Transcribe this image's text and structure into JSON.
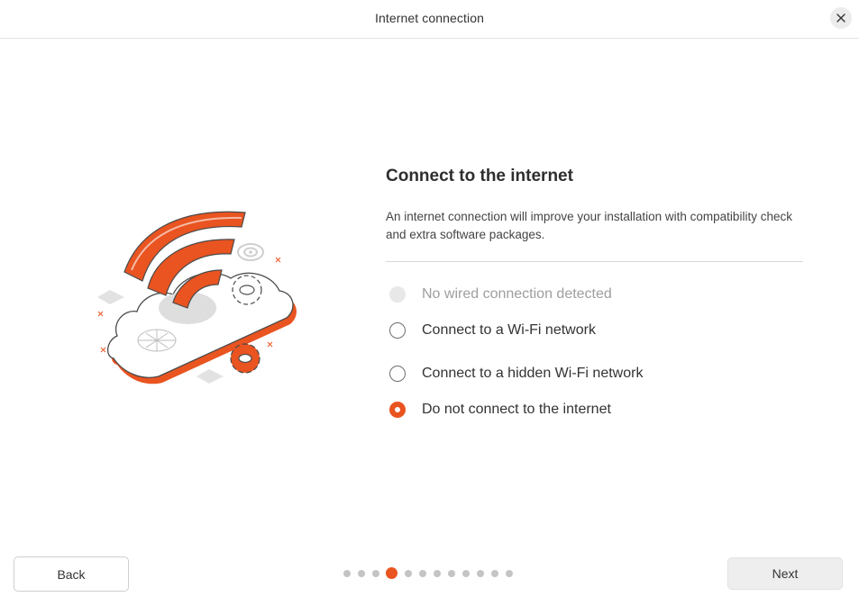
{
  "window": {
    "title": "Internet connection",
    "close_icon": "close-icon"
  },
  "main": {
    "heading": "Connect to the internet",
    "description": "An internet connection will improve your installation with compatibility check and extra software packages.",
    "options": [
      {
        "label": "No wired connection detected",
        "state": "disabled"
      },
      {
        "label": "Connect to a Wi-Fi network",
        "state": "unchecked"
      },
      {
        "label": "Connect to a hidden Wi-Fi network",
        "state": "unchecked"
      },
      {
        "label": "Do not connect to the internet",
        "state": "checked"
      }
    ],
    "illustration": "wifi-cloud-illustration"
  },
  "footer": {
    "back_label": "Back",
    "next_label": "Next",
    "pager": {
      "total": 12,
      "current": 4
    }
  },
  "colors": {
    "accent": "#e95420",
    "disabled": "#e8e8e8",
    "divider": "#d8d8d8"
  }
}
